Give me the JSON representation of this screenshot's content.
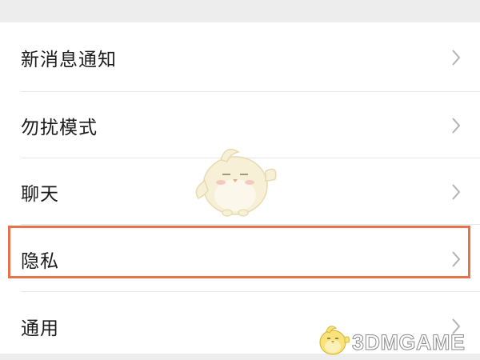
{
  "settings": {
    "items": [
      {
        "label": "新消息通知",
        "icon": "chevron-right-icon"
      },
      {
        "label": "勿扰模式",
        "icon": "chevron-right-icon"
      },
      {
        "label": "聊天",
        "icon": "chevron-right-icon"
      },
      {
        "label": "隐私",
        "icon": "chevron-right-icon",
        "highlighted": true
      },
      {
        "label": "通用",
        "icon": "chevron-right-icon"
      }
    ]
  },
  "annotation": {
    "highlight_color": "#e8704a"
  },
  "watermark": {
    "text": "3DMGAME"
  },
  "colors": {
    "background": "#ededed",
    "card": "#ffffff",
    "text": "#1a1a1a",
    "chevron": "#b2b2b2"
  }
}
